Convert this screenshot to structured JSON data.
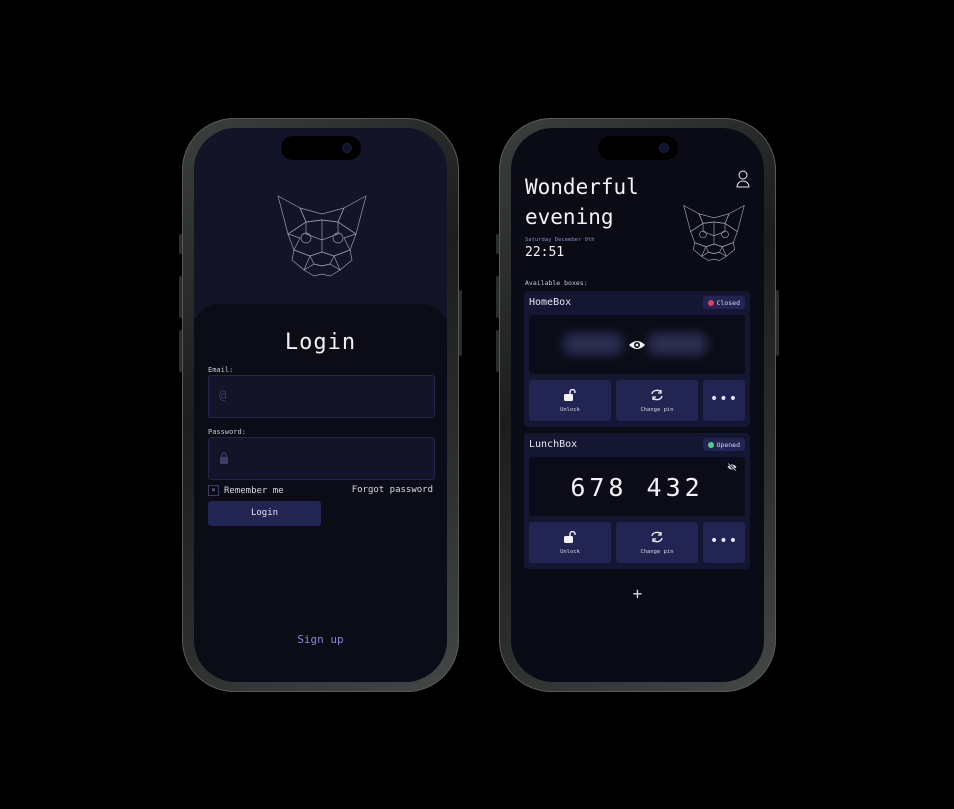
{
  "login_screen": {
    "title": "Login",
    "email_label": "Email:",
    "email_icon": "@",
    "password_label": "Password:",
    "remember_me": "Remember me",
    "checkbox_mark": "×",
    "forgot_password": "Forgot password",
    "login_button": "Login",
    "sign_up": "Sign up"
  },
  "dashboard": {
    "greeting": "Wonderful evening",
    "date": "Saturday December 9th",
    "time": "22:51",
    "available_label": "Available boxes:",
    "boxes": [
      {
        "name": "HomeBox",
        "status": "Closed",
        "status_color": "#e0405a",
        "pin_hidden": true,
        "actions": [
          "Unlock",
          "Change pin"
        ]
      },
      {
        "name": "LunchBox",
        "status": "Opened",
        "status_color": "#4fd08a",
        "pin": "678 432",
        "pin_hidden": false,
        "actions": [
          "Unlock",
          "Change pin"
        ]
      }
    ],
    "more_label": "•••",
    "add_label": "+"
  },
  "colors": {
    "background": "#0a0b14",
    "panel": "#151631",
    "button": "#222452",
    "accent": "#8a86d8"
  }
}
